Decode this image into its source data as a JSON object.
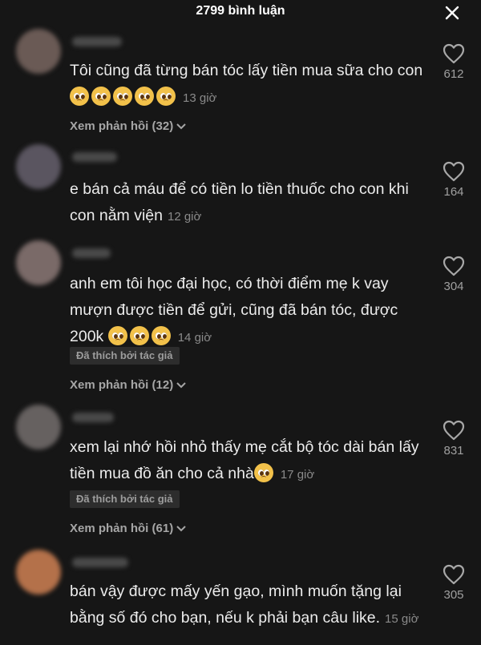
{
  "header": {
    "title": "2799 bình luận"
  },
  "comments": [
    {
      "text": "Tôi cũng đã từng bán tóc lấy tiền mua sữa cho con",
      "time": "13 giờ",
      "likes": "612",
      "replies": "Xem phản hồi (32)",
      "avatar_color": "#6a5a55"
    },
    {
      "text": "e bán cả máu để có tiền lo tiền thuốc cho con khi con nằm viện",
      "time": "12 giờ",
      "likes": "164",
      "avatar_color": "#5a5560"
    },
    {
      "text": "anh em tôi học đại học, có thời điểm mẹ k vay mượn được tiền để gửi, cũng đã bán tóc, được 200k",
      "time": "14 giờ",
      "likes": "304",
      "badge": "Đã thích bởi tác giả",
      "replies": "Xem phản hồi (12)",
      "avatar_color": "#7a6a68"
    },
    {
      "text": "xem lại nhớ hồi nhỏ thấy mẹ cắt bộ tóc dài bán lấy tiền mua đồ ăn cho cả nhà",
      "time": "17 giờ",
      "likes": "831",
      "badge": "Đã thích bởi tác giả",
      "replies": "Xem phản hồi (61)",
      "avatar_color": "#666160"
    },
    {
      "text": "bán vậy được mấy yến gạo, mình muốn tặng lại bằng số đó cho bạn, nếu k phải bạn câu like.",
      "time": "15 giờ",
      "likes": "305",
      "avatar_color": "#b4714a"
    }
  ]
}
